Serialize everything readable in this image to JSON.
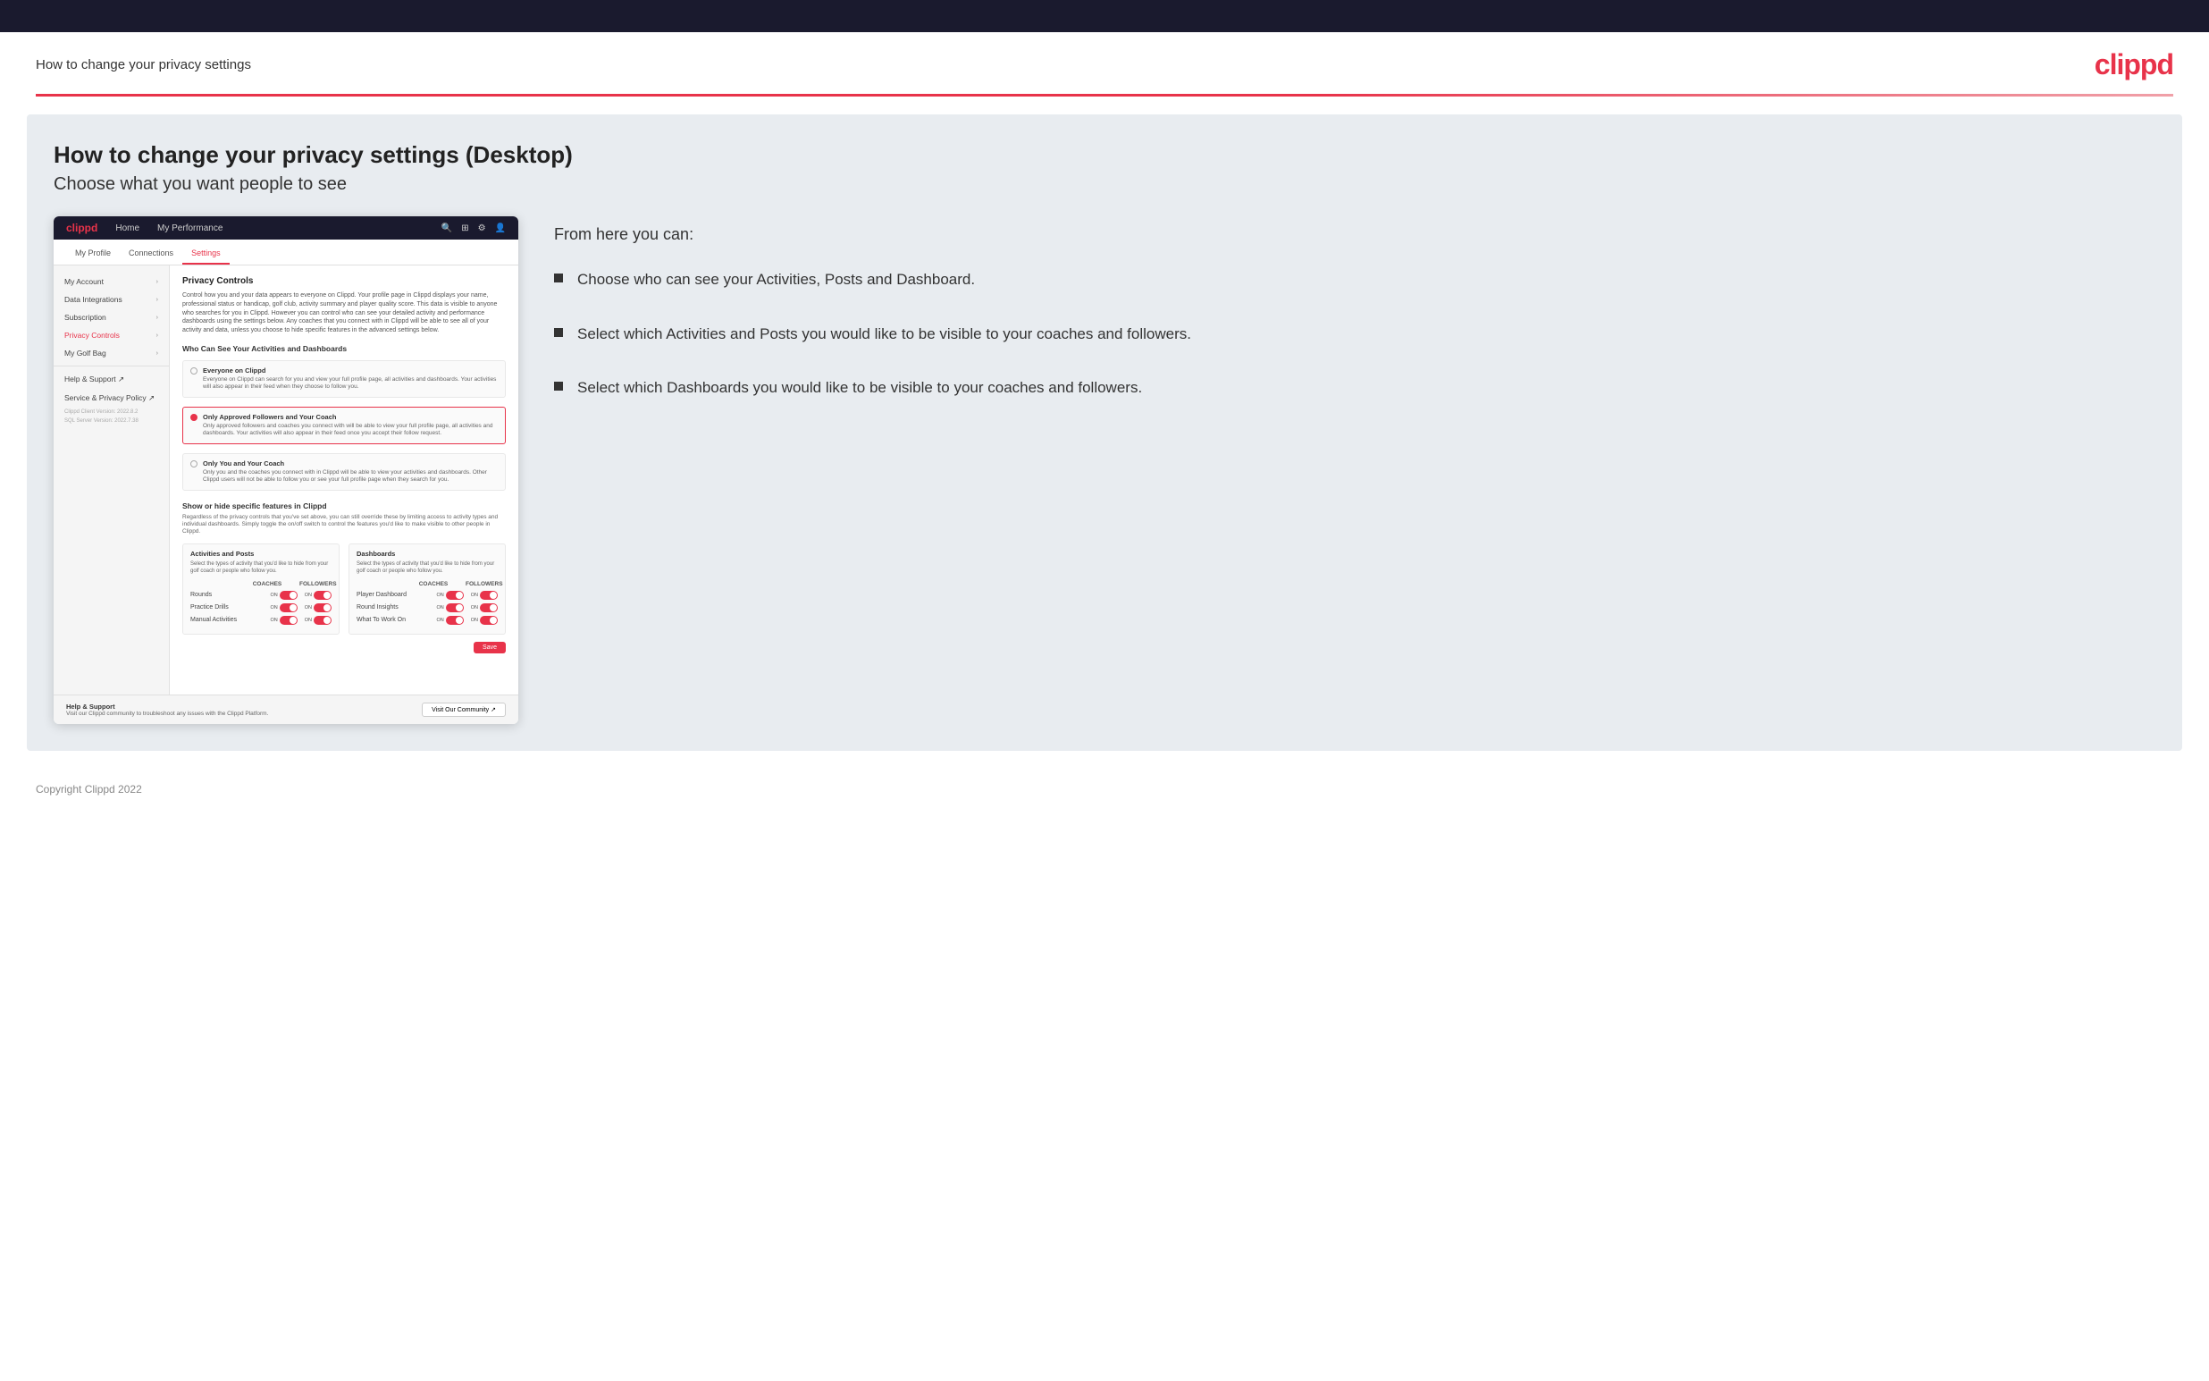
{
  "top_bar": {},
  "header": {
    "title": "How to change your privacy settings",
    "logo": "clippd"
  },
  "main": {
    "heading": "How to change your privacy settings (Desktop)",
    "subheading": "Choose what you want people to see",
    "right_col": {
      "from_here": "From here you can:",
      "bullets": [
        "Choose who can see your Activities, Posts and Dashboard.",
        "Select which Activities and Posts you would like to be visible to your coaches and followers.",
        "Select which Dashboards you would like to be visible to your coaches and followers."
      ]
    }
  },
  "mockup": {
    "nav": {
      "logo": "clippd",
      "links": [
        "Home",
        "My Performance"
      ],
      "icons": [
        "search",
        "grid",
        "settings",
        "user"
      ]
    },
    "subnav": {
      "items": [
        "My Profile",
        "Connections",
        "Settings"
      ],
      "active": "Settings"
    },
    "sidebar": {
      "items": [
        {
          "label": "My Account",
          "arrow": true,
          "active": false
        },
        {
          "label": "Data Integrations",
          "arrow": true,
          "active": false
        },
        {
          "label": "Subscription",
          "arrow": true,
          "active": false
        },
        {
          "label": "Privacy Controls",
          "arrow": true,
          "active": true
        },
        {
          "label": "My Golf Bag",
          "arrow": true,
          "active": false
        }
      ],
      "bottom_items": [
        {
          "label": "Help & Support ↗"
        },
        {
          "label": "Service & Privacy Policy ↗"
        }
      ],
      "version": [
        "Clippd Client Version: 2022.8.2",
        "SQL Server Version: 2022.7.38"
      ]
    },
    "main": {
      "section_title": "Privacy Controls",
      "section_desc": "Control how you and your data appears to everyone on Clippd. Your profile page in Clippd displays your name, professional status or handicap, golf club, activity summary and player quality score. This data is visible to anyone who searches for you in Clippd. However you can control who can see your detailed activity and performance dashboards using the settings below. Any coaches that you connect with in Clippd will be able to see all of your activity and data, unless you choose to hide specific features in the advanced settings below.",
      "who_can_see_title": "Who Can See Your Activities and Dashboards",
      "radio_options": [
        {
          "id": "everyone",
          "label": "Everyone on Clippd",
          "desc": "Everyone on Clippd can search for you and view your full profile page, all activities and dashboards. Your activities will also appear in their feed when they choose to follow you.",
          "selected": false
        },
        {
          "id": "followers",
          "label": "Only Approved Followers and Your Coach",
          "desc": "Only approved followers and coaches you connect with will be able to view your full profile page, all activities and dashboards. Your activities will also appear in their feed once you accept their follow request.",
          "selected": true
        },
        {
          "id": "coach_only",
          "label": "Only You and Your Coach",
          "desc": "Only you and the coaches you connect with in Clippd will be able to view your activities and dashboards. Other Clippd users will not be able to follow you or see your full profile page when they search for you.",
          "selected": false
        }
      ],
      "toggle_section_title": "Show or hide specific features in Clippd",
      "toggle_section_desc": "Regardless of the privacy controls that you've set above, you can still override these by limiting access to activity types and individual dashboards. Simply toggle the on/off switch to control the features you'd like to make visible to other people in Clippd.",
      "activities_col": {
        "title": "Activities and Posts",
        "desc": "Select the types of activity that you'd like to hide from your golf coach or people who follow you.",
        "headers": [
          "COACHES",
          "FOLLOWERS"
        ],
        "rows": [
          {
            "label": "Rounds",
            "coaches": "ON",
            "followers": "ON"
          },
          {
            "label": "Practice Drills",
            "coaches": "ON",
            "followers": "ON"
          },
          {
            "label": "Manual Activities",
            "coaches": "ON",
            "followers": "ON"
          }
        ]
      },
      "dashboards_col": {
        "title": "Dashboards",
        "desc": "Select the types of activity that you'd like to hide from your golf coach or people who follow you.",
        "headers": [
          "COACHES",
          "FOLLOWERS"
        ],
        "rows": [
          {
            "label": "Player Dashboard",
            "coaches": "ON",
            "followers": "ON"
          },
          {
            "label": "Round Insights",
            "coaches": "ON",
            "followers": "ON"
          },
          {
            "label": "What To Work On",
            "coaches": "ON",
            "followers": "ON"
          }
        ]
      },
      "save_button": "Save"
    },
    "help": {
      "title": "Help & Support",
      "desc": "Visit our Clippd community to troubleshoot any issues with the Clippd Platform.",
      "button": "Visit Our Community ↗"
    }
  },
  "footer": {
    "copyright": "Copyright Clippd 2022"
  }
}
